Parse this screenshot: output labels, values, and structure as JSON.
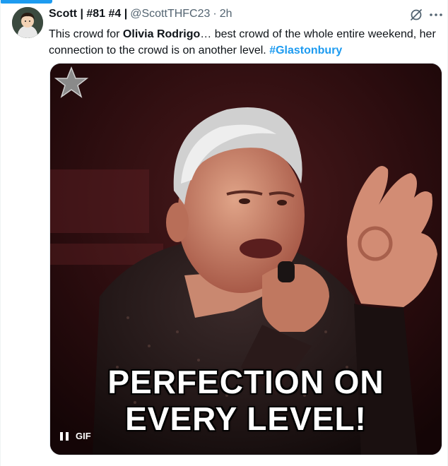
{
  "tweet": {
    "author": {
      "display_name": "Scott | #81 #4 |",
      "handle": "@ScottTHFC23",
      "separator": "·",
      "time": "2h"
    },
    "text": {
      "part1": "This crowd for ",
      "bold": "Olivia Rodrigo",
      "part2": "… best crowd of the whole entire weekend, her connection to the crowd is on another level. ",
      "hashtag": "#Glastonbury"
    },
    "media": {
      "caption_line1": "PERFECTION ON",
      "caption_line2": "EVERY LEVEL!",
      "badge_label": "GIF"
    }
  },
  "icons": {
    "avatar": "avatar-image",
    "grok": "grok-icon",
    "more": "more-icon",
    "pause": "pause-icon",
    "star": "star-icon"
  },
  "colors": {
    "link": "#1d9bf0",
    "secondary_text": "#536471",
    "primary_text": "#0f1419"
  }
}
